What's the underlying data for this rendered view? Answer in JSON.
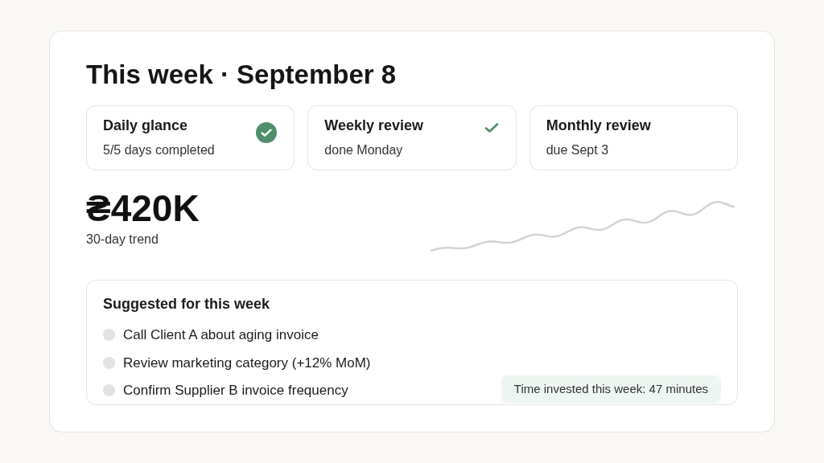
{
  "title": "This week · September 8",
  "reviews": [
    {
      "title": "Daily glance",
      "detail": "5/5 days completed",
      "kind": "badge"
    },
    {
      "title": "Weekly review",
      "detail": "done Monday",
      "kind": "check"
    },
    {
      "title": "Monthly review",
      "detail": "due Sept 3",
      "kind": "none"
    }
  ],
  "metric": {
    "value": "₴420K",
    "caption": "30-day trend"
  },
  "suggestions": {
    "title": "Suggested for this week",
    "items": [
      {
        "label": "Call Client A about aging invoice",
        "checked": false
      },
      {
        "label": "Review marketing category (+12% MoM)",
        "checked": false
      },
      {
        "label": "Confirm Supplier B invoice frequency",
        "checked": false
      }
    ],
    "time_note": "Time invested this week: 47 minutes"
  }
}
